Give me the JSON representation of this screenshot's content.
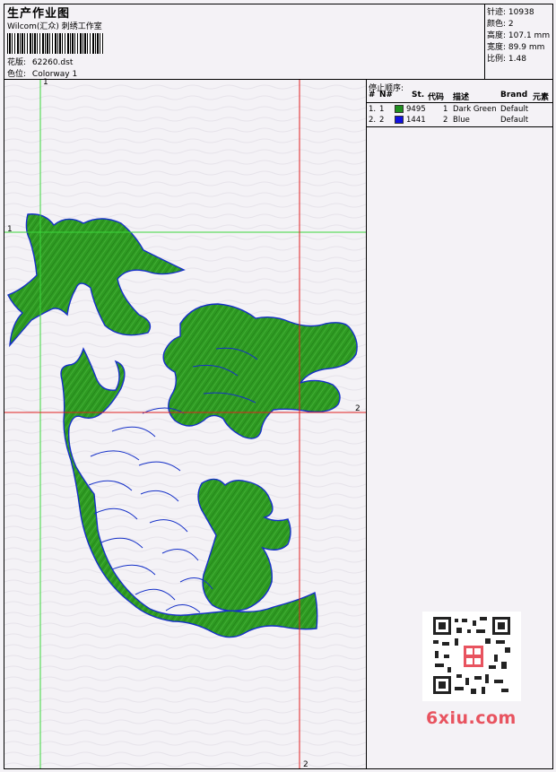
{
  "header": {
    "title": "生产作业图",
    "subtitle": "Wilcom(汇众) 刺绣工作室",
    "design_label": "花版:",
    "design_value": "62260.dst",
    "colorway_label": "色位:",
    "colorway_value": "Colorway 1"
  },
  "stats": {
    "stitches_label": "针迹:",
    "stitches_value": "10938",
    "colors_label": "颜色:",
    "colors_value": "2",
    "height_label": "高度:",
    "height_value": "107.1 mm",
    "width_label": "宽度:",
    "width_value": "89.9 mm",
    "scale_label": "比例:",
    "scale_value": "1.48"
  },
  "stop_sequence": {
    "title": "停止顺序:",
    "headers": [
      "#",
      "N#",
      "St.",
      "代码",
      "描述",
      "Brand",
      "元素"
    ],
    "rows": [
      {
        "num": "1.",
        "n": "1",
        "color": "#1f8f1f",
        "st": "9495",
        "code": "1",
        "desc": "Dark Green",
        "brand": "Default"
      },
      {
        "num": "2.",
        "n": "2",
        "color": "#1010e0",
        "st": "1441",
        "code": "2",
        "desc": "Blue",
        "brand": "Default"
      }
    ]
  },
  "guides": {
    "green_top_label": "1",
    "green_left_label": "1",
    "red_right_label": "2",
    "red_bottom_label": "2"
  },
  "colors": {
    "fill_green": "#2e9a22",
    "outline_blue": "#1530c8",
    "guide_green": "#3ad63a",
    "guide_red": "#e02020"
  },
  "watermark": {
    "text": "6xiu.com"
  }
}
